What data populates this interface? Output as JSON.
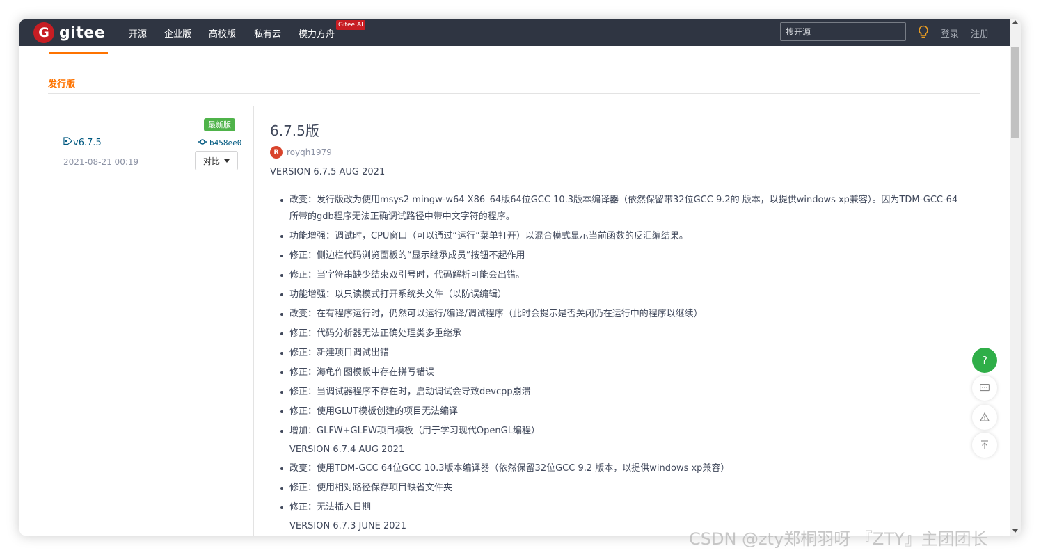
{
  "nav": {
    "logo_text": "gitee",
    "logo_letter": "G",
    "items": [
      "开源",
      "企业版",
      "高校版",
      "私有云",
      "模力方舟"
    ],
    "ai_badge": "Gitee AI",
    "search_placeholder": "搜开源",
    "login": "登录",
    "register": "注册"
  },
  "section": {
    "title": "发行版"
  },
  "release": {
    "latest_badge": "最新版",
    "tag": "v6.7.5",
    "commit": "b458ee0",
    "date": "2021-08-21 00:19",
    "compare_label": "对比",
    "title": "6.7.5版",
    "author_initial": "R",
    "author": "royqh1979",
    "version_line": "VERSION 6.7.5 AUG 2021",
    "changes": [
      "改变：发行版改为使用msys2 mingw-w64 X86_64版64位GCC 10.3版本编译器（依然保留带32位GCC 9.2的 版本，以提供windows xp兼容）。因为TDM-GCC-64所带的gdb程序无法正确调试路径中带中文字符的程序。",
      "功能增强：调试时，CPU窗口（可以通过“运行”菜单打开）以混合模式显示当前函数的反汇编结果。",
      "修正：侧边栏代码浏览面板的“显示继承成员”按钮不起作用",
      "修正：当字符串缺少结束双引号时，代码解析可能会出错。",
      "功能增强：以只读模式打开系统头文件（以防误编辑）",
      "改变：在有程序运行时，仍然可以运行/编译/调试程序（此时会提示是否关闭仍在运行中的程序以继续）",
      "修正：代码分析器无法正确处理类多重继承",
      "修正：新建项目调试出错",
      "修正：海龟作图模板中存在拼写错误",
      "修正：当调试器程序不存在时，启动调试会导致devcpp崩溃",
      "修正：使用GLUT模板创建的项目无法编译",
      "增加：GLFW+GLEW项目模板（用于学习现代OpenGL编程）"
    ],
    "version_674": "VERSION 6.7.4 AUG 2021",
    "changes_674": [
      "改变：使用TDM-GCC 64位GCC 10.3版本编译器（依然保留32位GCC 9.2 版本，以提供windows xp兼容）",
      "修正：使用相对路径保存项目缺省文件夹",
      "修正：无法插入日期"
    ],
    "version_673": "VERSION 6.7.3 JUNE 2021"
  },
  "float_buttons": {
    "help": "?"
  },
  "watermark": "CSDN @zty郑桐羽呀    『ZTY』主团团长",
  "colors": {
    "nav_bg": "#2f3542",
    "brand": "#c71d23",
    "accent": "#fe7300",
    "green": "#4fb34a"
  }
}
